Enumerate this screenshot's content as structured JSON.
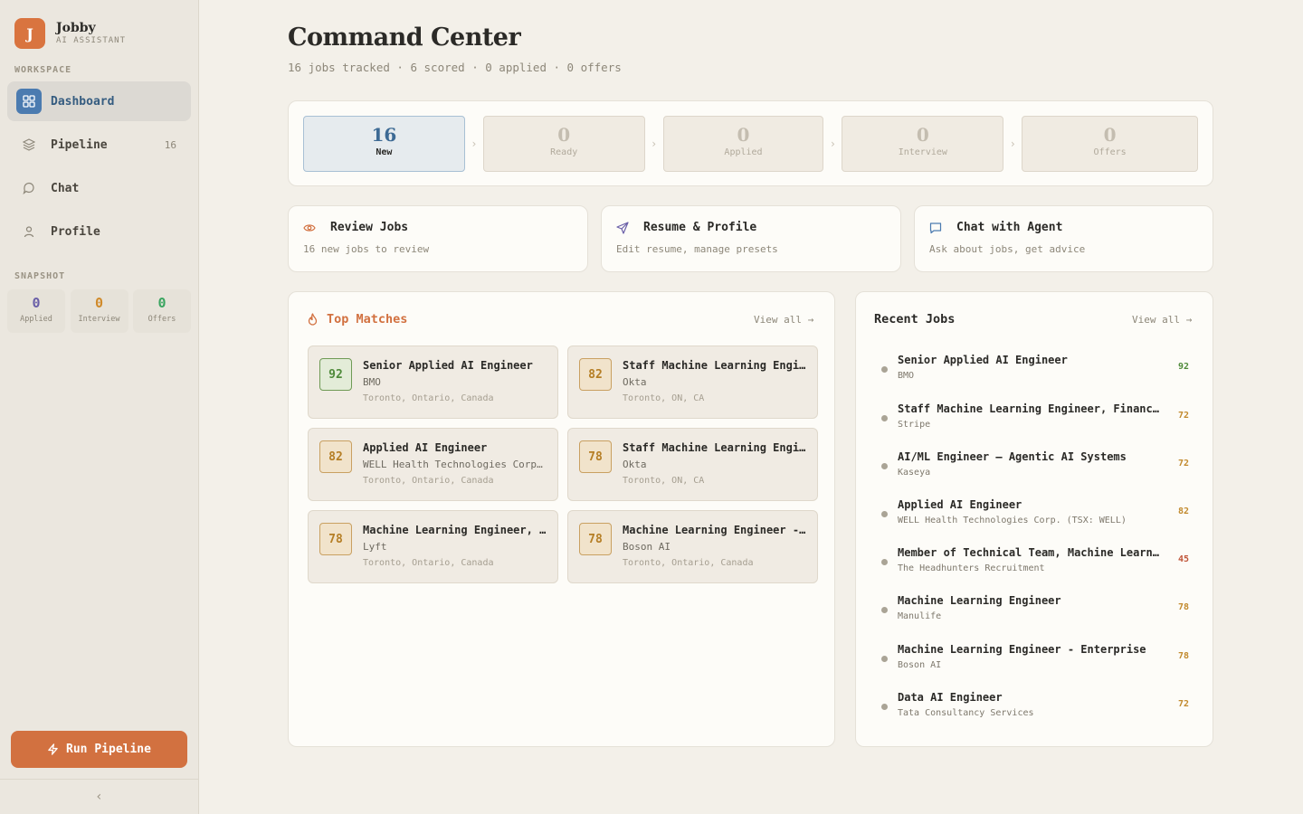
{
  "app": {
    "name": "Jobby",
    "subtitle": "AI ASSISTANT",
    "logo_letter": "J"
  },
  "sidebar": {
    "workspace_label": "WORKSPACE",
    "nav": [
      {
        "label": "Dashboard",
        "icon": "grid-icon",
        "active": true,
        "count": ""
      },
      {
        "label": "Pipeline",
        "icon": "layers-icon",
        "active": false,
        "count": "16"
      },
      {
        "label": "Chat",
        "icon": "chat-bubble-icon",
        "active": false,
        "count": ""
      },
      {
        "label": "Profile",
        "icon": "user-icon",
        "active": false,
        "count": ""
      }
    ],
    "snapshot_label": "SNAPSHOT",
    "snapshot": [
      {
        "value": "0",
        "label": "Applied",
        "color": "#6a5fa8"
      },
      {
        "value": "0",
        "label": "Interview",
        "color": "#d08a2a"
      },
      {
        "value": "0",
        "label": "Offers",
        "color": "#3aa560"
      }
    ],
    "run_button": "Run Pipeline",
    "collapse_icon": "‹"
  },
  "header": {
    "title": "Command Center",
    "subtitle": "16 jobs tracked · 6 scored · 0 applied · 0 offers"
  },
  "stages": [
    {
      "value": "16",
      "label": "New",
      "active": true
    },
    {
      "value": "0",
      "label": "Ready",
      "active": false
    },
    {
      "value": "0",
      "label": "Applied",
      "active": false
    },
    {
      "value": "0",
      "label": "Interview",
      "active": false
    },
    {
      "value": "0",
      "label": "Offers",
      "active": false
    }
  ],
  "quick_actions": [
    {
      "title": "Review Jobs",
      "subtitle": "16 new jobs to review",
      "icon": "eye-icon"
    },
    {
      "title": "Resume & Profile",
      "subtitle": "Edit resume, manage presets",
      "icon": "send-icon"
    },
    {
      "title": "Chat with Agent",
      "subtitle": "Ask about jobs, get advice",
      "icon": "chat-bubble-icon"
    }
  ],
  "top_matches": {
    "title": "Top Matches",
    "view_all": "View all →",
    "items": [
      {
        "score": "92",
        "title": "Senior Applied AI Engineer",
        "company": "BMO",
        "location": "Toronto, Ontario, Canada",
        "tier": "high"
      },
      {
        "score": "82",
        "title": "Staff Machine Learning Engineer, Financial Services",
        "company": "Okta",
        "location": "Toronto, ON, CA",
        "tier": "mid"
      },
      {
        "score": "82",
        "title": "Applied AI Engineer",
        "company": "WELL Health Technologies Corp. (TSX: WELL)",
        "location": "Toronto, Ontario, Canada",
        "tier": "mid"
      },
      {
        "score": "78",
        "title": "Staff Machine Learning Engineer",
        "company": "Okta",
        "location": "Toronto, ON, CA",
        "tier": "mid"
      },
      {
        "score": "78",
        "title": "Machine Learning Engineer, Search",
        "company": "Lyft",
        "location": "Toronto, Ontario, Canada",
        "tier": "mid"
      },
      {
        "score": "78",
        "title": "Machine Learning Engineer - Enterprise",
        "company": "Boson AI",
        "location": "Toronto, Ontario, Canada",
        "tier": "mid"
      }
    ]
  },
  "recent_jobs": {
    "title": "Recent Jobs",
    "view_all": "View all →",
    "items": [
      {
        "title": "Senior Applied AI Engineer",
        "company": "BMO",
        "score": "92",
        "color": "#4f8a3a"
      },
      {
        "title": "Staff Machine Learning Engineer, Financial Services",
        "company": "Stripe",
        "score": "72",
        "color": "#c28a2e"
      },
      {
        "title": "AI/ML Engineer — Agentic AI Systems",
        "company": "Kaseya",
        "score": "72",
        "color": "#c28a2e"
      },
      {
        "title": "Applied AI Engineer",
        "company": "WELL Health Technologies Corp. (TSX: WELL)",
        "score": "82",
        "color": "#c28a2e"
      },
      {
        "title": "Member of Technical Team, Machine Learning",
        "company": "The Headhunters Recruitment",
        "score": "45",
        "color": "#c0563a"
      },
      {
        "title": "Machine Learning Engineer",
        "company": "Manulife",
        "score": "78",
        "color": "#c28a2e"
      },
      {
        "title": "Machine Learning Engineer - Enterprise",
        "company": "Boson AI",
        "score": "78",
        "color": "#c28a2e"
      },
      {
        "title": "Data AI Engineer",
        "company": "Tata Consultancy Services",
        "score": "72",
        "color": "#c28a2e"
      }
    ]
  },
  "colors": {
    "accent": "#d27140",
    "primary": "#4b7bb0",
    "score_high": "#4f8a3a",
    "score_mid": "#c28a2e"
  }
}
